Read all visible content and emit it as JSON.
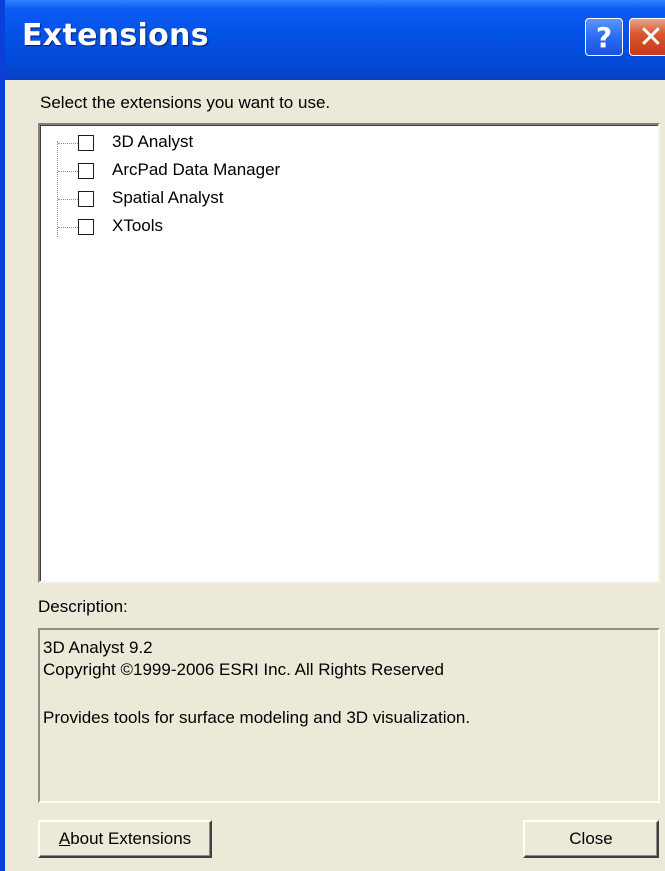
{
  "window": {
    "title": "Extensions",
    "help_glyph": "?",
    "close_glyph": "✕"
  },
  "prompt": "Select the extensions you want to use.",
  "extensions": [
    {
      "label": "3D Analyst",
      "checked": false
    },
    {
      "label": "ArcPad Data Manager",
      "checked": false
    },
    {
      "label": "Spatial Analyst",
      "checked": false
    },
    {
      "label": "XTools",
      "checked": false
    }
  ],
  "description": {
    "label": "Description:",
    "lines": [
      "3D Analyst 9.2",
      "Copyright ©1999-2006 ESRI Inc. All Rights Reserved",
      "",
      "Provides tools for surface modeling and 3D visualization."
    ]
  },
  "buttons": {
    "about_mnemonic": "A",
    "about_rest": "bout Extensions",
    "close": "Close"
  },
  "colors": {
    "titlebar": "#0352e6",
    "dialog_bg": "#ece9d8"
  }
}
